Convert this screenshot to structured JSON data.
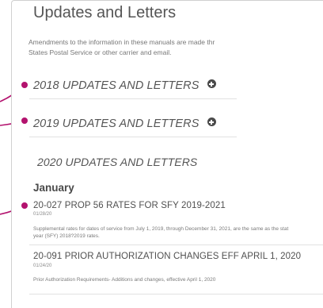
{
  "page": {
    "title": "Updates and Letters",
    "intro_line1": "Amendments to the information in these manuals are made thr",
    "intro_line2": "States Postal Service or other carrier and email."
  },
  "sections": [
    {
      "label": "2018 UPDATES AND LETTERS",
      "icon": "plus-circle-icon"
    },
    {
      "label": "2019 UPDATES AND LETTERS",
      "icon": "plus-circle-icon"
    },
    {
      "label": "2020 UPDATES AND LETTERS"
    }
  ],
  "month": "January",
  "items": [
    {
      "title": "20-027 PROP 56 RATES FOR SFY 2019-2021",
      "date": "01/28/20",
      "desc_line1": "Supplemental rates for dates of service from July 1, 2019, through December 31, 2021, are the same as the stat",
      "desc_line2": "year (SFY) 2018?2019 rates."
    },
    {
      "title": "20-091 PRIOR AUTHORIZATION CHANGES EFF APRIL 1, 2020",
      "date": "01/24/20",
      "desc_line1": "Prior Authorization Requirements- Additions and changes, effective April 1, 2020"
    }
  ],
  "colors": {
    "callout": "#b3126e",
    "text": "#555555",
    "icon": "#4a4a4a"
  }
}
